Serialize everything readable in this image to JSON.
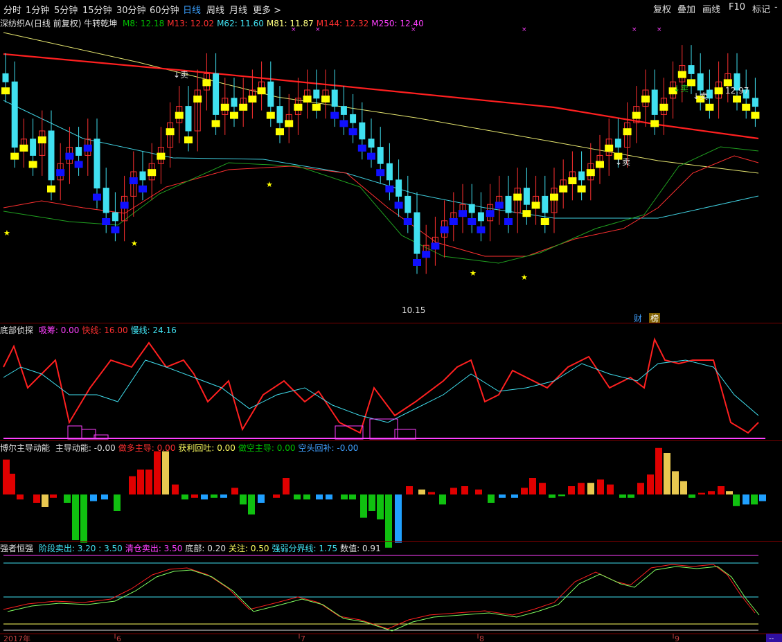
{
  "toolbar": {
    "periods": [
      "分时",
      "1分钟",
      "5分钟",
      "15分钟",
      "30分钟",
      "60分钟",
      "日线",
      "周线",
      "月线",
      "更多 >"
    ],
    "active": "日线",
    "right": [
      "复权",
      "叠加",
      "画线",
      "F10",
      "标记",
      "-"
    ]
  },
  "main_panel": {
    "title": "深纺织A(日线 前复权) 牛转乾坤",
    "ma": [
      {
        "label": "M8: 12.18",
        "color": "#00c000"
      },
      {
        "label": "M13: 12.02",
        "color": "#ff3030"
      },
      {
        "label": "M62: 11.60",
        "color": "#40e0f0"
      },
      {
        "label": "M81: 11.87",
        "color": "#ffff80"
      },
      {
        "label": "M144: 12.32",
        "color": "#ff3030"
      },
      {
        "label": "M250: 12.40",
        "color": "#ff40ff"
      }
    ],
    "annotations": {
      "high": "12.97",
      "low": "10.15",
      "sell": "卖",
      "cai": "财",
      "bang": "榜"
    }
  },
  "ind1": {
    "title": "底部侦探",
    "items": [
      {
        "label": "吸筹: 0.00",
        "color": "#ff40ff"
      },
      {
        "label": "快线: 16.00",
        "color": "#ff3030"
      },
      {
        "label": "慢线: 24.16",
        "color": "#40e0f0"
      }
    ]
  },
  "ind2": {
    "title": "博尔主导动能",
    "items": [
      {
        "label": "主导动能: -0.00",
        "color": "#e0e0e0"
      },
      {
        "label": "做多主导: 0.00",
        "color": "#ff3030"
      },
      {
        "label": "获利回吐: 0.00",
        "color": "#ffff60"
      },
      {
        "label": "做空主导: 0.00",
        "color": "#00c000"
      },
      {
        "label": "空头回补: -0.00",
        "color": "#40a0ff"
      }
    ]
  },
  "ind3": {
    "title": "强者恒强",
    "items": [
      {
        "label": "阶段卖出: 3.20 : 3.50",
        "color": "#40e0f0"
      },
      {
        "label": "清仓卖出: 3.50",
        "color": "#ff40ff"
      },
      {
        "label": "底部: 0.20",
        "color": "#e0e0e0"
      },
      {
        "label": "关注: 0.50",
        "color": "#ffff60"
      },
      {
        "label": "强弱分界线: 1.75",
        "color": "#40e0f0"
      },
      {
        "label": "数值: 0.91",
        "color": "#e0e0e0"
      }
    ]
  },
  "xaxis": {
    "year": "2017年",
    "months": [
      "6",
      "7",
      "8",
      "9"
    ]
  },
  "corner": "--",
  "chart_data": {
    "type": "candlestick",
    "title": "深纺织A(日线 前复权)",
    "price_high": 12.97,
    "price_low": 10.15,
    "ma_latest": {
      "M8": 12.18,
      "M13": 12.02,
      "M62": 11.6,
      "M81": 11.87,
      "M144": 12.32,
      "M250": 12.4
    },
    "indicators": {
      "吸筹": 0.0,
      "快线": 16.0,
      "慢线": 24.16,
      "主导动能": 0.0,
      "做多主导": 0.0,
      "获利回吐": 0.0,
      "做空主导": 0.0,
      "空头回补": 0.0,
      "阶段卖出": [
        3.2,
        3.5
      ],
      "清仓卖出": 3.5,
      "底部": 0.2,
      "关注": 0.5,
      "强弱分界线": 1.75,
      "数值": 0.91
    }
  }
}
